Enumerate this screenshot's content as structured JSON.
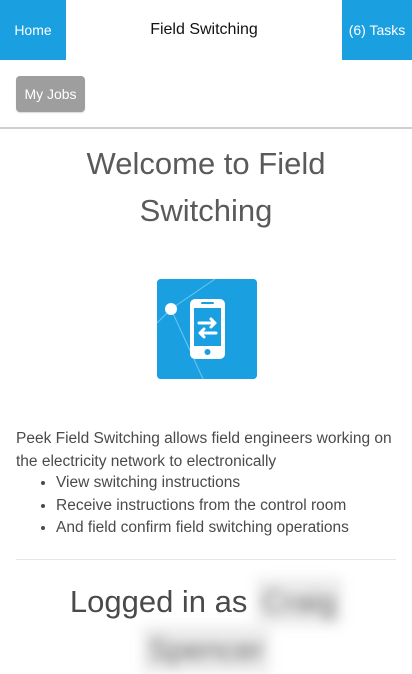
{
  "header": {
    "home_label": "Home",
    "title": "Field Switching",
    "tasks_label": "(6) Tasks"
  },
  "toolbar": {
    "my_jobs_label": "My Jobs"
  },
  "main": {
    "welcome_line1": "Welcome to Field",
    "welcome_line2": "Switching",
    "app_icon": "field-switching-app-icon",
    "intro_text": "Peek Field Switching allows field engineers working on the electricity network to electronically",
    "features": [
      "View switching instructions",
      "Receive instructions from the control room",
      "And field confirm field switching operations"
    ],
    "logged_in_prefix": "Logged in as",
    "user_first": "Craig",
    "user_last": "Spencer"
  },
  "colors": {
    "accent": "#1a9fe0",
    "button_grey": "#9e9e9e",
    "text": "#4a4a4a"
  }
}
